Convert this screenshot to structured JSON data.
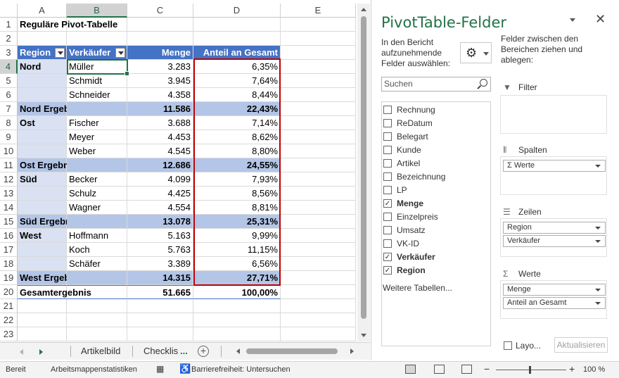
{
  "columns": [
    "A",
    "B",
    "C",
    "D",
    "E"
  ],
  "rows": [
    {
      "n": "1",
      "type": "title",
      "a": "Reguläre Pivot-Tabelle",
      "b": "",
      "c": "",
      "d": ""
    },
    {
      "n": "2",
      "type": "empty",
      "a": "",
      "b": "",
      "c": "",
      "d": ""
    },
    {
      "n": "3",
      "type": "header",
      "a": "Region",
      "b": "Verkäufer",
      "c": "Menge",
      "d": "Anteil an Gesamt"
    },
    {
      "n": "4",
      "type": "data",
      "a": "Nord",
      "b": "Müller",
      "c": "3.283",
      "d": "6,35%"
    },
    {
      "n": "5",
      "type": "data",
      "a": "",
      "b": "Schmidt",
      "c": "3.945",
      "d": "7,64%"
    },
    {
      "n": "6",
      "type": "data",
      "a": "",
      "b": "Schneider",
      "c": "4.358",
      "d": "8,44%"
    },
    {
      "n": "7",
      "type": "sub",
      "a": "Nord Ergebnis",
      "b": "",
      "c": "11.586",
      "d": "22,43%"
    },
    {
      "n": "8",
      "type": "data",
      "a": "Ost",
      "b": "Fischer",
      "c": "3.688",
      "d": "7,14%"
    },
    {
      "n": "9",
      "type": "data",
      "a": "",
      "b": "Meyer",
      "c": "4.453",
      "d": "8,62%"
    },
    {
      "n": "10",
      "type": "data",
      "a": "",
      "b": "Weber",
      "c": "4.545",
      "d": "8,80%"
    },
    {
      "n": "11",
      "type": "sub",
      "a": "Ost Ergebnis",
      "b": "",
      "c": "12.686",
      "d": "24,55%"
    },
    {
      "n": "12",
      "type": "data",
      "a": "Süd",
      "b": "Becker",
      "c": "4.099",
      "d": "7,93%"
    },
    {
      "n": "13",
      "type": "data",
      "a": "",
      "b": "Schulz",
      "c": "4.425",
      "d": "8,56%"
    },
    {
      "n": "14",
      "type": "data",
      "a": "",
      "b": "Wagner",
      "c": "4.554",
      "d": "8,81%"
    },
    {
      "n": "15",
      "type": "sub",
      "a": "Süd Ergebnis",
      "b": "",
      "c": "13.078",
      "d": "25,31%"
    },
    {
      "n": "16",
      "type": "data",
      "a": "West",
      "b": "Hoffmann",
      "c": "5.163",
      "d": "9,99%"
    },
    {
      "n": "17",
      "type": "data",
      "a": "",
      "b": "Koch",
      "c": "5.763",
      "d": "11,15%"
    },
    {
      "n": "18",
      "type": "data",
      "a": "",
      "b": "Schäfer",
      "c": "3.389",
      "d": "6,56%"
    },
    {
      "n": "19",
      "type": "sub",
      "a": "West Ergebnis",
      "b": "",
      "c": "14.315",
      "d": "27,71%"
    },
    {
      "n": "20",
      "type": "total",
      "a": "Gesamtergebnis",
      "b": "",
      "c": "51.665",
      "d": "100,00%"
    },
    {
      "n": "21",
      "type": "empty",
      "a": "",
      "b": "",
      "c": "",
      "d": ""
    },
    {
      "n": "22",
      "type": "empty",
      "a": "",
      "b": "",
      "c": "",
      "d": ""
    },
    {
      "n": "23",
      "type": "empty",
      "a": "",
      "b": "",
      "c": "",
      "d": ""
    }
  ],
  "sheet_tabs": {
    "tab1": "Artikelbild",
    "tab2": "Checklis",
    "more": "..."
  },
  "status": {
    "ready": "Bereit",
    "stats": "Arbeitsmappenstatistiken",
    "accessibility": "Barrierefreiheit: Untersuchen",
    "zoom_minus": "−",
    "zoom_plus": "+",
    "zoom": "100 %"
  },
  "pivot_panel": {
    "title": "PivotTable-Felder",
    "close": "✕",
    "choose_label": "In den Bericht aufzunehmende Felder auswählen:",
    "drag_label": "Felder zwischen den Bereichen ziehen und ablegen:",
    "search_placeholder": "Suchen",
    "fields": [
      {
        "label": "Rechnung",
        "checked": false
      },
      {
        "label": "ReDatum",
        "checked": false
      },
      {
        "label": "Belegart",
        "checked": false
      },
      {
        "label": "Kunde",
        "checked": false
      },
      {
        "label": "Artikel",
        "checked": false
      },
      {
        "label": "Bezeichnung",
        "checked": false
      },
      {
        "label": "LP",
        "checked": false
      },
      {
        "label": "Menge",
        "checked": true
      },
      {
        "label": "Einzelpreis",
        "checked": false
      },
      {
        "label": "Umsatz",
        "checked": false
      },
      {
        "label": "VK-ID",
        "checked": false
      },
      {
        "label": "Verkäufer",
        "checked": true
      },
      {
        "label": "Region",
        "checked": true
      }
    ],
    "more_tables": "Weitere Tabellen...",
    "areas": {
      "filter": {
        "label": "Filter",
        "items": []
      },
      "columns": {
        "label": "Spalten",
        "items": [
          "Werte"
        ]
      },
      "rows": {
        "label": "Zeilen",
        "items": [
          "Region",
          "Verkäufer"
        ]
      },
      "values": {
        "label": "Werte",
        "items": [
          "Menge",
          "Anteil an Gesamt"
        ]
      }
    },
    "defer_label": "Layo...",
    "update_button": "Aktualisieren"
  },
  "icons": {
    "gear": "gear-icon",
    "search": "search-icon",
    "filter": "filter-icon",
    "columns": "columns-icon",
    "rows": "rows-icon",
    "values": "sigma-icon"
  }
}
